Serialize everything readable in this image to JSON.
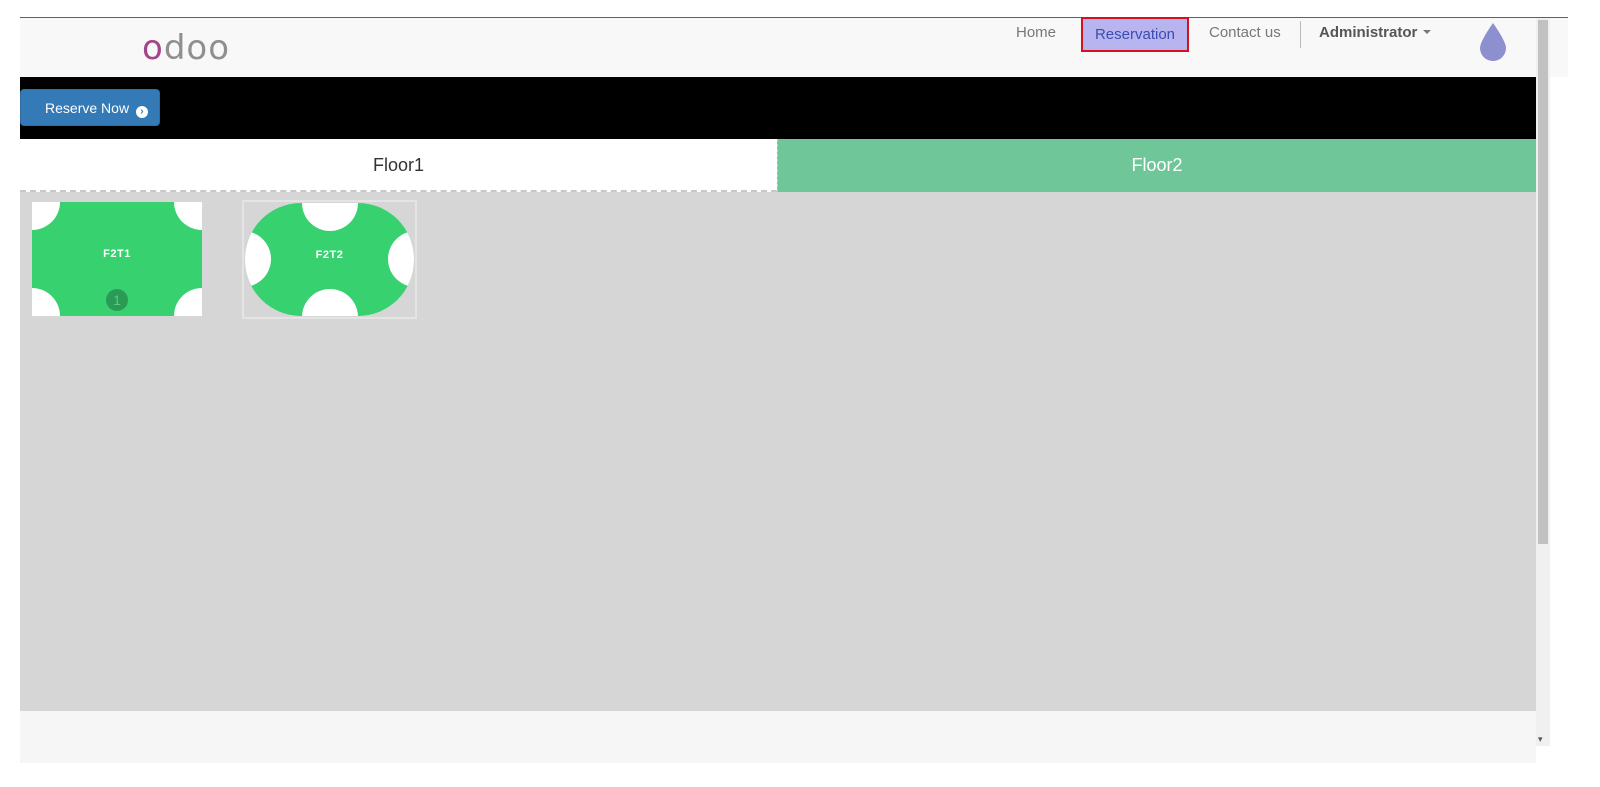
{
  "header": {
    "logo": "odoo",
    "nav": {
      "home": "Home",
      "reservation": "Reservation",
      "contact": "Contact us",
      "user": "Administrator"
    }
  },
  "toolbar": {
    "reserve_label": "Reserve Now"
  },
  "tabs": [
    {
      "label": "Floor1",
      "active": false
    },
    {
      "label": "Floor2",
      "active": true
    }
  ],
  "tables": [
    {
      "label": "F2T1",
      "shape": "rectangle",
      "count": "1"
    },
    {
      "label": "F2T2",
      "shape": "round"
    }
  ],
  "colors": {
    "table_green": "#37d170",
    "active_tab": "#6fc799",
    "button_blue": "#337ab7",
    "highlight": "#b7b4f0",
    "logo_accent": "#a24689"
  }
}
